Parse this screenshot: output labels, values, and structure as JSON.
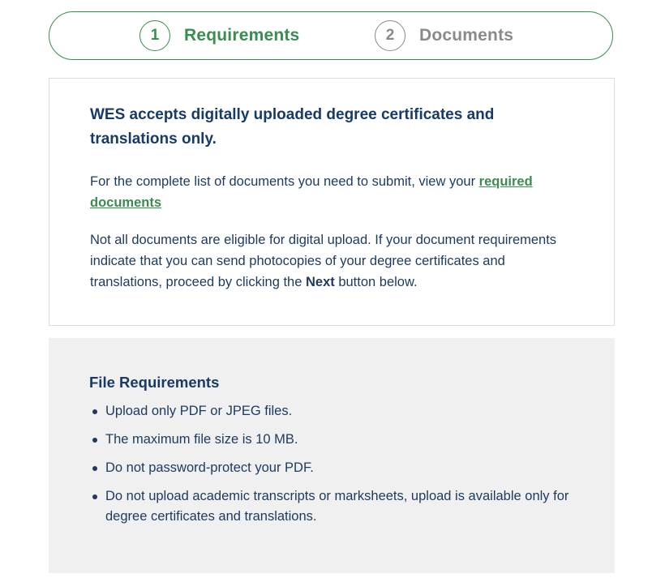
{
  "stepper": {
    "steps": [
      {
        "number": "1",
        "label": "Requirements",
        "state": "active"
      },
      {
        "number": "2",
        "label": "Documents",
        "state": "inactive"
      }
    ]
  },
  "info": {
    "heading": "WES accepts digitally uploaded degree certificates and translations only.",
    "p1_text": "For the complete list of documents you need to submit, view your ",
    "p1_link": "required documents",
    "p2_before": "Not all documents are eligible for digital upload. If your document requirements indicate that you can send photocopies of your degree certificates and translations, proceed by clicking the ",
    "p2_strong": "Next",
    "p2_after": " button below."
  },
  "file_requirements": {
    "heading": "File Requirements",
    "items": [
      "Upload only PDF or JPEG files.",
      "The maximum file size is 10 MB.",
      "Do not password-protect your PDF.",
      "Do not upload academic transcripts or marksheets, upload is available only for degree certificates and translations."
    ]
  },
  "colors": {
    "accent_green": "#3a8c4f",
    "inactive_gray": "#8a8a8a",
    "navy_text": "#173a66",
    "panel_gray": "#f0f0f0"
  }
}
